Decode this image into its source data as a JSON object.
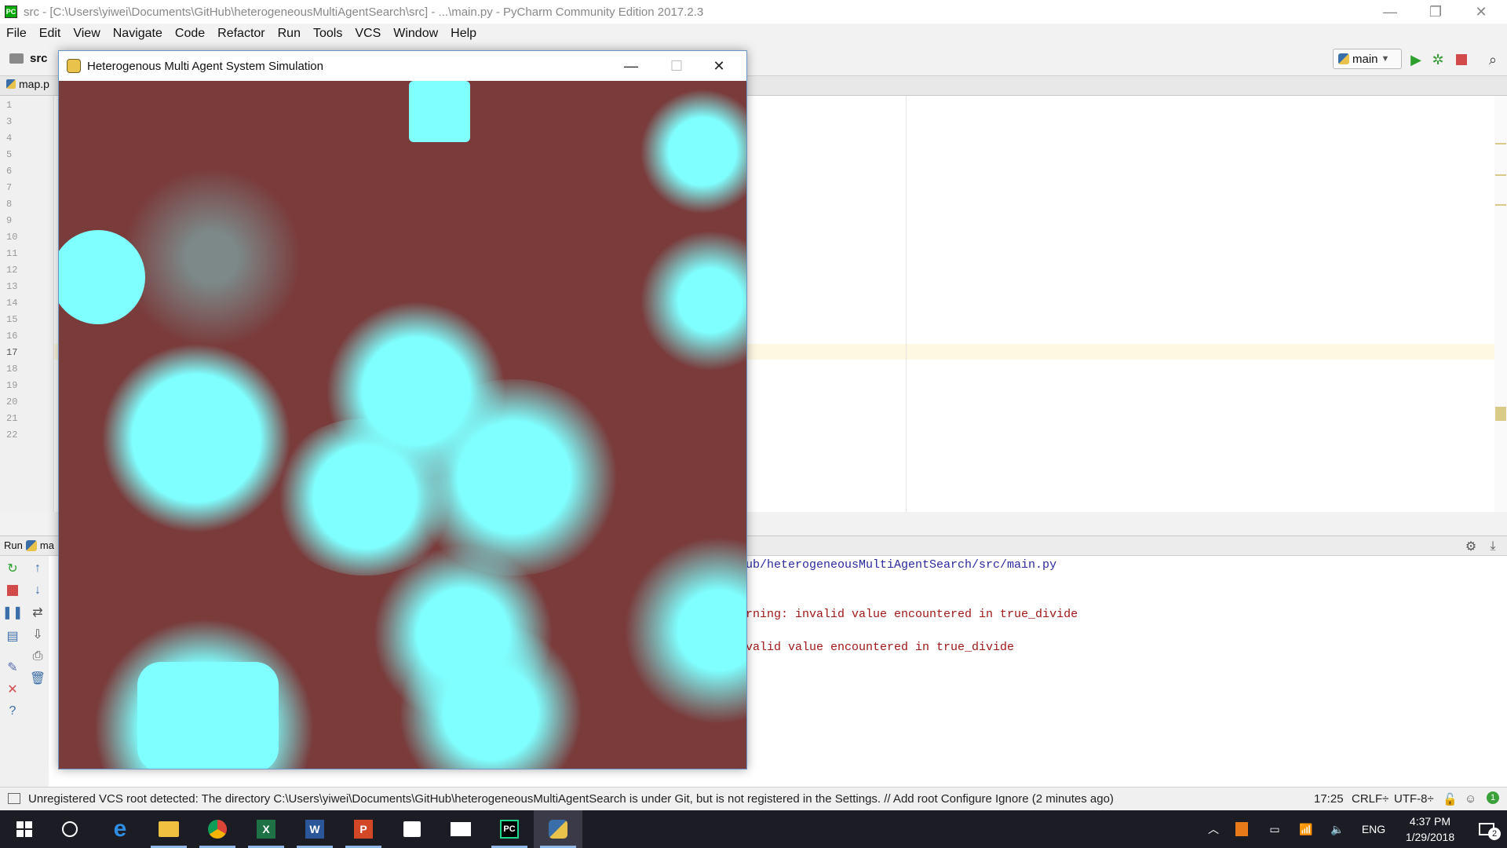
{
  "ide": {
    "title": "src - [C:\\Users\\yiwei\\Documents\\GitHub\\heterogeneousMultiAgentSearch\\src] - ...\\main.py - PyCharm Community Edition 2017.2.3",
    "menu": [
      "File",
      "Edit",
      "View",
      "Navigate",
      "Code",
      "Refactor",
      "Run",
      "Tools",
      "VCS",
      "Window",
      "Help"
    ],
    "breadcrumb": "src",
    "open_tab": "map.p",
    "run_config": "main",
    "line_numbers": [
      "1",
      "3",
      "4",
      "5",
      "6",
      "7",
      "8",
      "9",
      "10",
      "11",
      "12",
      "13",
      "14",
      "15",
      "16",
      "17",
      "18",
      "19",
      "20",
      "21",
      "22"
    ],
    "current_line": "17",
    "run_panel": {
      "label": "Run",
      "config_short": "ma",
      "console": [
        "ub/heterogeneousMultiAgentSearch/src/main.py",
        "rning: invalid value encountered in true_divide",
        "valid value encountered in true_divide"
      ]
    },
    "status": {
      "message": "Unregistered VCS root detected: The directory C:\\Users\\yiwei\\Documents\\GitHub\\heterogeneousMultiAgentSearch is under Git, but is not registered in the Settings. // Add root  Configure  Ignore (2 minutes ago)",
      "position": "17:25",
      "line_sep": "CRLF÷",
      "encoding": "UTF-8÷",
      "notifications": "1"
    }
  },
  "sim_window": {
    "title": "Heterogenous Multi Agent System Simulation",
    "background": "#7a3b3b",
    "agent_color": "#7fffff"
  },
  "taskbar": {
    "lang": "ENG",
    "time": "4:37 PM",
    "date": "1/29/2018",
    "notif_count": "2"
  },
  "colors": {
    "caret_line": "#fdf8e1",
    "console_path": "#2a2aa0",
    "console_error": "#a01818"
  }
}
